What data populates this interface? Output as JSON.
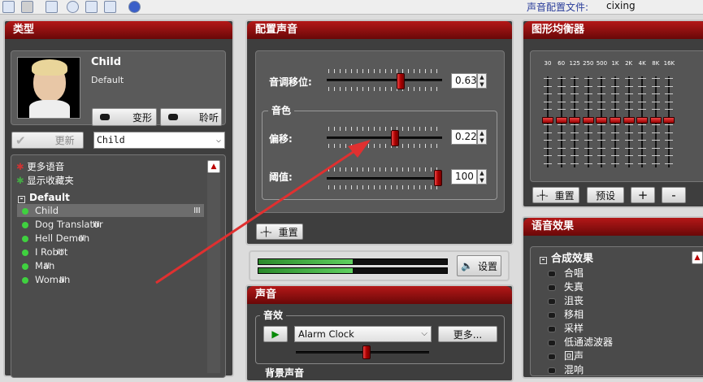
{
  "toolbar": {
    "icons": [
      "app-icon",
      "window-icon",
      "plugin-icon",
      "clock-icon",
      "waveform-icon",
      "sound-icon",
      "help-icon"
    ],
    "config_label": "声音配置文件:",
    "config_value": "cixing"
  },
  "type_panel": {
    "title": "类型",
    "voice_name": "Child",
    "voice_sub": "Default",
    "morph_label": "变形",
    "listen_label": "聆听",
    "update_label": "更新",
    "voice_select": "Child",
    "more_voices": "更多语音",
    "show_favorites": "显示收藏夹",
    "group_label": "Default",
    "items": [
      "Child",
      "Dog Translator",
      "Hell Demon",
      "I Robot",
      "Man",
      "Woman"
    ],
    "selected_index": 0
  },
  "config_panel": {
    "title": "配置声音",
    "pitch_label": "音调移位:",
    "pitch_value": "0.63",
    "timbre_group": "音色",
    "offset_label": "偏移:",
    "offset_value": "0.22",
    "threshold_label": "阈值:",
    "threshold_value": "100",
    "reset_label": "重置"
  },
  "meters": {
    "settings_label": "设置",
    "level_top": 0.5,
    "level_bottom": 0.5
  },
  "sound_panel": {
    "title": "声音",
    "effect_group": "音效",
    "effect_select": "Alarm Clock",
    "more_label": "更多...",
    "bg_label": "背景声音"
  },
  "eq_panel": {
    "title": "图形均衡器",
    "bands": [
      "30",
      "60",
      "125",
      "250",
      "500",
      "1K",
      "2K",
      "4K",
      "8K",
      "16K"
    ],
    "reset_label": "重置",
    "preset_label": "预设",
    "plus_label": "+",
    "minus_label": "-"
  },
  "effects_panel": {
    "title": "语音效果",
    "group_label": "合成效果",
    "items": [
      "合唱",
      "失真",
      "沮丧",
      "移相",
      "采样",
      "低通滤波器",
      "回声",
      "混响"
    ]
  },
  "colors": {
    "title_red": "#a01010",
    "panel_dark": "#3e3e3e",
    "annotation_arrow": "#e03030"
  }
}
